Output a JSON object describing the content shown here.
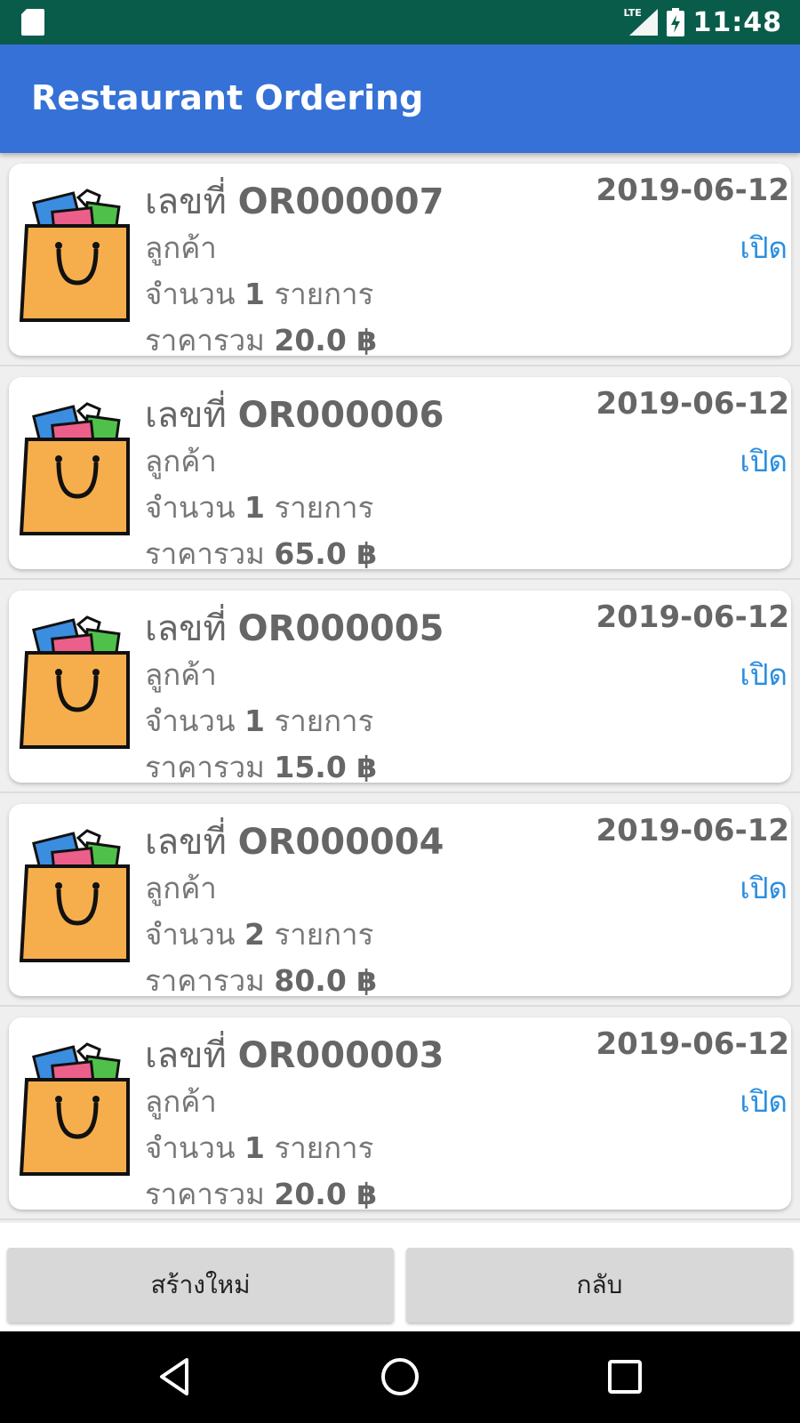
{
  "status_bar": {
    "time": "11:48",
    "signal_label": "LTE"
  },
  "app_bar": {
    "title": "Restaurant Ordering"
  },
  "orders": [
    {
      "label": "เลขที่",
      "number": "OR000007",
      "customer": "ลูกค้า",
      "qty_prefix": "จำนวน",
      "qty": "1",
      "qty_suffix": "รายการ",
      "total_prefix": "ราคารวม",
      "total": "20.0 ฿",
      "date": "2019-06-12",
      "status": "เปิด"
    },
    {
      "label": "เลขที่",
      "number": "OR000006",
      "customer": "ลูกค้า",
      "qty_prefix": "จำนวน",
      "qty": "1",
      "qty_suffix": "รายการ",
      "total_prefix": "ราคารวม",
      "total": "65.0 ฿",
      "date": "2019-06-12",
      "status": "เปิด"
    },
    {
      "label": "เลขที่",
      "number": "OR000005",
      "customer": "ลูกค้า",
      "qty_prefix": "จำนวน",
      "qty": "1",
      "qty_suffix": "รายการ",
      "total_prefix": "ราคารวม",
      "total": "15.0 ฿",
      "date": "2019-06-12",
      "status": "เปิด"
    },
    {
      "label": "เลขที่",
      "number": "OR000004",
      "customer": "ลูกค้า",
      "qty_prefix": "จำนวน",
      "qty": "2",
      "qty_suffix": "รายการ",
      "total_prefix": "ราคารวม",
      "total": "80.0 ฿",
      "date": "2019-06-12",
      "status": "เปิด"
    },
    {
      "label": "เลขที่",
      "number": "OR000003",
      "customer": "ลูกค้า",
      "qty_prefix": "จำนวน",
      "qty": "1",
      "qty_suffix": "รายการ",
      "total_prefix": "ราคารวม",
      "total": "20.0 ฿",
      "date": "2019-06-12",
      "status": "เปิด"
    }
  ],
  "buttons": {
    "new_label": "สร้างใหม่",
    "back_label": "กลับ"
  },
  "icons": {
    "order": "shopping-bag-icon",
    "nav_back": "back-triangle-icon",
    "nav_home": "home-circle-icon",
    "nav_recent": "recents-square-icon"
  },
  "colors": {
    "status_bar": "#0a5c4a",
    "app_bar": "#3571d6",
    "status_open": "#2a8ee0",
    "bag_body": "#f6ae4d"
  }
}
